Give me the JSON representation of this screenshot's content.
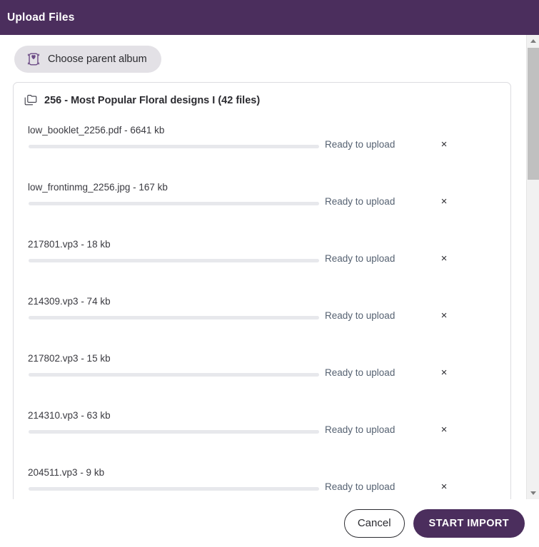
{
  "window": {
    "title": "Upload Files",
    "header_color": "#4b2e5d"
  },
  "toolbar": {
    "parent_album_label": "Choose parent album",
    "parent_album_icon": "album-collection-icon"
  },
  "album": {
    "icon": "folders-copy-icon",
    "title": "256 - Most Popular Floral designs I (42 files)"
  },
  "files": [
    {
      "name": "low_booklet_2256.pdf - 6641 kb",
      "status": "Ready to upload",
      "progress": 0,
      "remove_icon": "close-icon"
    },
    {
      "name": "low_frontinmg_2256.jpg - 167 kb",
      "status": "Ready to upload",
      "progress": 0,
      "remove_icon": "close-icon"
    },
    {
      "name": "217801.vp3 - 18 kb",
      "status": "Ready to upload",
      "progress": 0,
      "remove_icon": "close-icon"
    },
    {
      "name": "214309.vp3 - 74 kb",
      "status": "Ready to upload",
      "progress": 0,
      "remove_icon": "close-icon"
    },
    {
      "name": "217802.vp3 - 15 kb",
      "status": "Ready to upload",
      "progress": 0,
      "remove_icon": "close-icon"
    },
    {
      "name": "214310.vp3 - 63 kb",
      "status": "Ready to upload",
      "progress": 0,
      "remove_icon": "close-icon"
    },
    {
      "name": "204511.vp3 - 9 kb",
      "status": "Ready to upload",
      "progress": 0,
      "remove_icon": "close-icon"
    }
  ],
  "remove_glyph": "×",
  "scrollbar": {
    "up_icon": "chevron-up-icon",
    "down_icon": "chevron-down-icon"
  },
  "footer": {
    "cancel_label": "Cancel",
    "import_label": "START IMPORT"
  }
}
